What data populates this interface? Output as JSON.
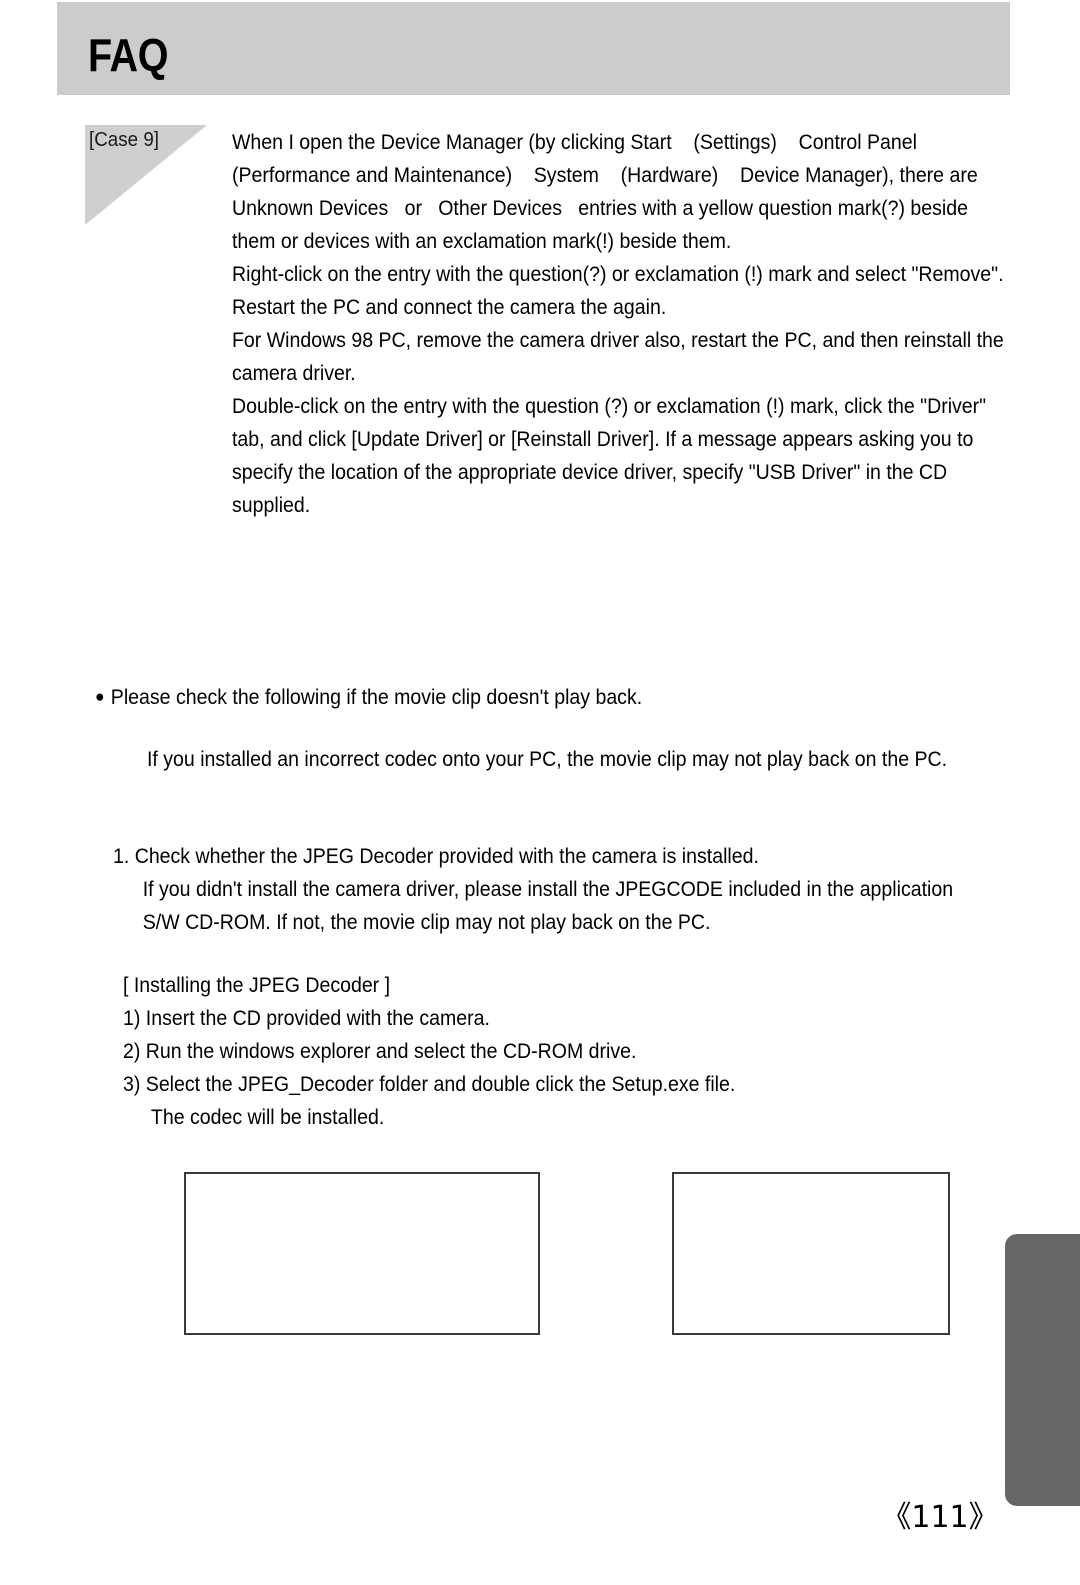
{
  "header": {
    "title": "FAQ",
    "bar_color": "#cccccc"
  },
  "case": {
    "label": "[Case 9]",
    "marker_color": "#cfcfcf",
    "paragraphs": [
      "When I open the Device Manager (by clicking Start    (Settings)    Control Panel    (Performance and Maintenance)    System    (Hardware)    Device Manager), there are   Unknown Devices   or   Other Devices   entries with a yellow question mark(?) beside them or devices with an exclamation mark(!) beside them.",
      "Right-click on the entry with the question(?) or exclamation (!) mark and select \"Remove\". Restart the PC and connect the camera the again.",
      "For Windows 98 PC, remove the camera driver also, restart the PC, and then reinstall the camera driver.",
      "Double-click on the entry with the question (?) or exclamation (!) mark, click the \"Driver\" tab, and click [Update Driver] or [Reinstall Driver]. If a message appears asking you to specify the location of the appropriate device driver, specify \"USB Driver\" in the CD supplied."
    ]
  },
  "movie_section": {
    "bullet_glyph": "●",
    "bullet_text": "Please check the following if the movie clip doesn't play back.",
    "codec_note": "If you installed an incorrect codec onto your PC, the movie clip may not play back on the PC.",
    "item_1": "1. Check whether the JPEG Decoder provided with the camera is installed.",
    "item_1_sub": "If you didn't install the camera driver, please install the JPEGCODE included in the application S/W CD-ROM. If not, the movie clip may not play back on the PC.",
    "install_heading": "[ Installing the JPEG Decoder ]",
    "install_steps": [
      "1) Insert the CD provided with the camera.",
      "2) Run the windows explorer and select the CD-ROM drive.",
      "3) Select the JPEG_Decoder folder and double click the Setup.exe file."
    ],
    "install_continuation": "The codec will be installed."
  },
  "figures": {
    "left_box_label": "",
    "right_box_label": ""
  },
  "footer": {
    "page_number": "《111》",
    "tab_color": "#666666"
  }
}
